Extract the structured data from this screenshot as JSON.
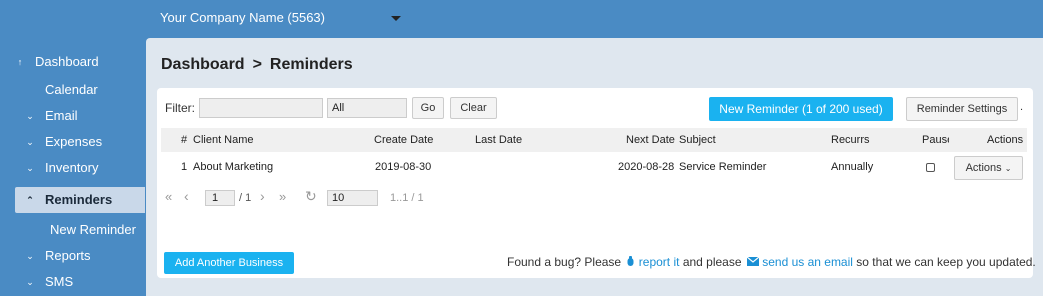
{
  "header": {
    "company": "Your Company Name (5563)"
  },
  "sidebar": {
    "items": [
      {
        "label": "Dashboard",
        "icon": "arrow-up-icon",
        "glyph": "↑"
      },
      {
        "label": "Calendar",
        "icon": "",
        "glyph": ""
      },
      {
        "label": "Email",
        "icon": "chevron-down-icon",
        "glyph": "⌄"
      },
      {
        "label": "Expenses",
        "icon": "chevron-down-icon",
        "glyph": "⌄"
      },
      {
        "label": "Inventory",
        "icon": "chevron-down-icon",
        "glyph": "⌄"
      },
      {
        "label": "Reminders",
        "icon": "chevron-up-icon",
        "glyph": "⌃"
      },
      {
        "label": "New Reminder",
        "icon": "",
        "glyph": ""
      },
      {
        "label": "Reports",
        "icon": "chevron-down-icon",
        "glyph": "⌄"
      },
      {
        "label": "SMS",
        "icon": "chevron-down-icon",
        "glyph": "⌄"
      }
    ]
  },
  "breadcrumb": {
    "parent": "Dashboard",
    "current": "Reminders",
    "separator": ">"
  },
  "toolbar": {
    "filter_label": "Filter:",
    "filter_value": "",
    "filter_select": "All",
    "go_label": "Go",
    "clear_label": "Clear",
    "new_reminder_label": "New Reminder (1 of 200 used)",
    "settings_label": "Reminder Settings",
    "settings_trailing": "."
  },
  "table": {
    "columns": [
      "#",
      "Client Name",
      "Create Date",
      "Last Date",
      "Next Date",
      "Subject",
      "Recurrs",
      "Pause",
      "Actions"
    ],
    "rows": [
      {
        "num": "1",
        "client": "About Marketing",
        "create_date": "2019-08-30",
        "last_date": "",
        "next_date": "2020-08-28",
        "subject": "Service Reminder",
        "recurrs": "Annually",
        "paused": false,
        "actions_label": "Actions"
      }
    ]
  },
  "pager": {
    "page": "1",
    "of": "/ 1",
    "page_size": "10",
    "range": "1..1 / 1",
    "first": "«",
    "prev": "‹",
    "next": "›",
    "last": "»",
    "refresh": "↻"
  },
  "footer": {
    "add_business_label": "Add Another Business",
    "bug_text_1": "Found a bug? Please",
    "report_link": "report it",
    "bug_text_2": "and please",
    "email_link": "send us an email",
    "bug_text_3": "so that we can keep you updated."
  },
  "colors": {
    "background": "#4a8bc4",
    "accent": "#1ab2f0",
    "link": "#1a8fd4"
  }
}
